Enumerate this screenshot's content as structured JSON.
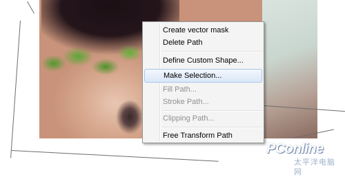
{
  "context_menu": {
    "items": [
      {
        "label": "Create vector mask",
        "enabled": true
      },
      {
        "label": "Delete Path",
        "enabled": true
      },
      {
        "label": "Define Custom Shape...",
        "enabled": true
      },
      {
        "label": "Make Selection...",
        "enabled": true,
        "highlighted": true
      },
      {
        "label": "Fill Path...",
        "enabled": false
      },
      {
        "label": "Stroke Path...",
        "enabled": false
      },
      {
        "label": "Clipping Path...",
        "enabled": false
      },
      {
        "label": "Free Transform Path",
        "enabled": true
      }
    ],
    "colors": {
      "background": "#f4f4f4",
      "border": "#979797",
      "disabled_text": "#8f8f8f",
      "highlight_border": "#a8c6ea"
    }
  },
  "watermark": {
    "logo": "PConline",
    "subtitle": "太平洋电脑网"
  }
}
